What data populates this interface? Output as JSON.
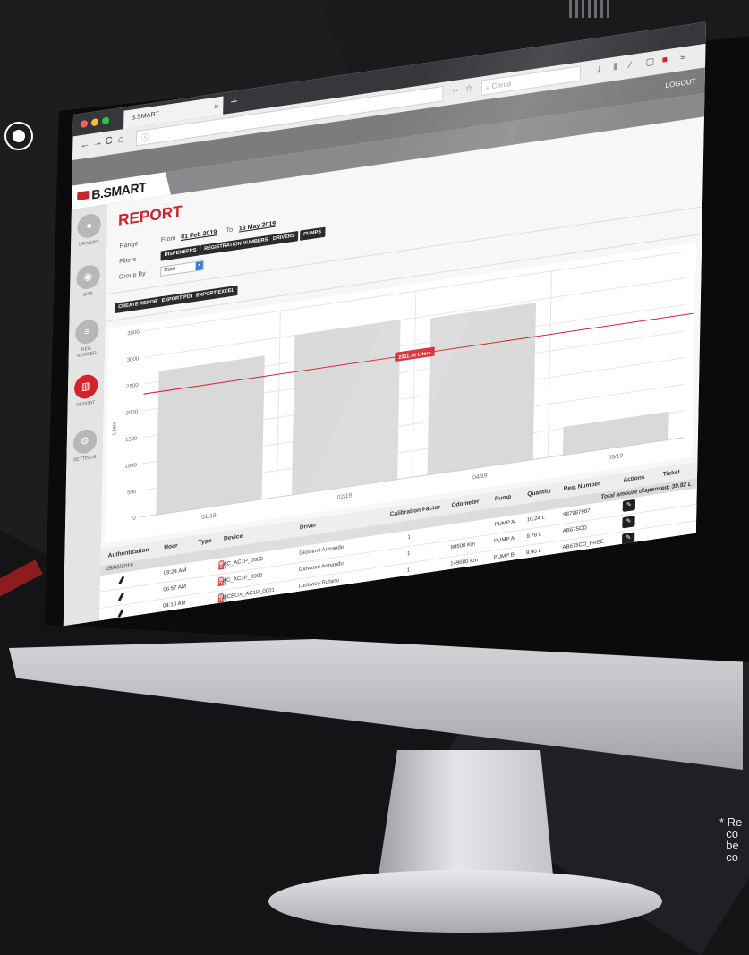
{
  "background": {
    "footnote": "* Re\n  co\n  be\n  co"
  },
  "browser": {
    "tab_title": "B.SMART",
    "tab_close": "×",
    "new_tab": "+",
    "url": "ⓘ",
    "search_placeholder": "Cerca",
    "more_menu": "···",
    "nav": {
      "back": "←",
      "forward": "→",
      "reload": "C",
      "home": "⌂"
    },
    "toolbar_icons": [
      "download-icon",
      "library-icon",
      "pipette-icon",
      "sidebar-icon",
      "extension-icon",
      "menu-icon"
    ]
  },
  "app": {
    "logo": "B.SMART",
    "logout_label": "LOGOUT",
    "accent": "#c9252b",
    "sidebar": [
      {
        "label": "DRIVERS",
        "icon": "user-icon",
        "glyph": "●"
      },
      {
        "label": "SITE",
        "icon": "location-pin-icon",
        "glyph": "◉"
      },
      {
        "label": "REG. NUMBER",
        "icon": "list-icon",
        "glyph": "≡"
      },
      {
        "label": "REPORT",
        "icon": "bar-chart-icon",
        "glyph": "▥",
        "active": true
      },
      {
        "label": "SETTINGS",
        "icon": "gear-icon",
        "glyph": "⚙"
      }
    ]
  },
  "report": {
    "title": "REPORT",
    "range_label": "Range",
    "from_label": "From",
    "from_date": "01 Feb 2019",
    "to_label": "To",
    "to_date": "13 May 2019",
    "filters_label": "Filters",
    "filters": [
      "DISPENSERS",
      "REGISTRATION NUMBERS",
      "DRIVERS",
      "PUMPS"
    ],
    "group_by_label": "Group By",
    "group_by_value": "Date",
    "actions": [
      "CREATE REPORT",
      "EXPORT PDF",
      "EXPORT EXCEL"
    ]
  },
  "chart_data": {
    "type": "bar",
    "categories": [
      "01/19",
      "02/19",
      "04/19",
      "05/19"
    ],
    "values": [
      2700,
      3000,
      2950,
      530
    ],
    "ylabel": "Liters",
    "ylim": [
      0,
      3500
    ],
    "yticks": [
      0,
      500,
      1000,
      1500,
      2000,
      2500,
      3000,
      3500
    ],
    "reference_line": {
      "value": 2311.7,
      "label": "2311.70 Liters",
      "color": "#d5232a"
    },
    "bar_color": "#d9d9d9",
    "grid": true
  },
  "table": {
    "headers": [
      "Authentication",
      "Hour",
      "Type",
      "Device",
      "Driver",
      "Calibration Factor",
      "Odometer",
      "Pump",
      "Quantity",
      "Reg. Number",
      "Actions",
      "Ticket"
    ],
    "date": "05/06/2019",
    "total": "Total amount dispensed: 39.92 L",
    "rows": [
      {
        "hour": "09:24 AM",
        "device": "AC_AC1P_0002",
        "driver": "Giovanni Armando",
        "calibration": "1",
        "odometer": "",
        "pump": "PUMP A",
        "quantity": "10.24 L",
        "reg": "987987987"
      },
      {
        "hour": "06:57 AM",
        "device": "AC_AC1P_0002",
        "driver": "Giovanni Armando",
        "calibration": "1",
        "odometer": "90500 Km",
        "pump": "PUMP A",
        "quantity": "9.78 L",
        "reg": "AB675CD"
      },
      {
        "hour": "04:10 AM",
        "device": "MCBOX_AC1P_0001",
        "driver": "Ludovico Rufano",
        "calibration": "1",
        "odometer": "149680 Km",
        "pump": "PUMP B",
        "quantity": "9.90 L",
        "reg": "AB675CD_FREE"
      }
    ]
  }
}
